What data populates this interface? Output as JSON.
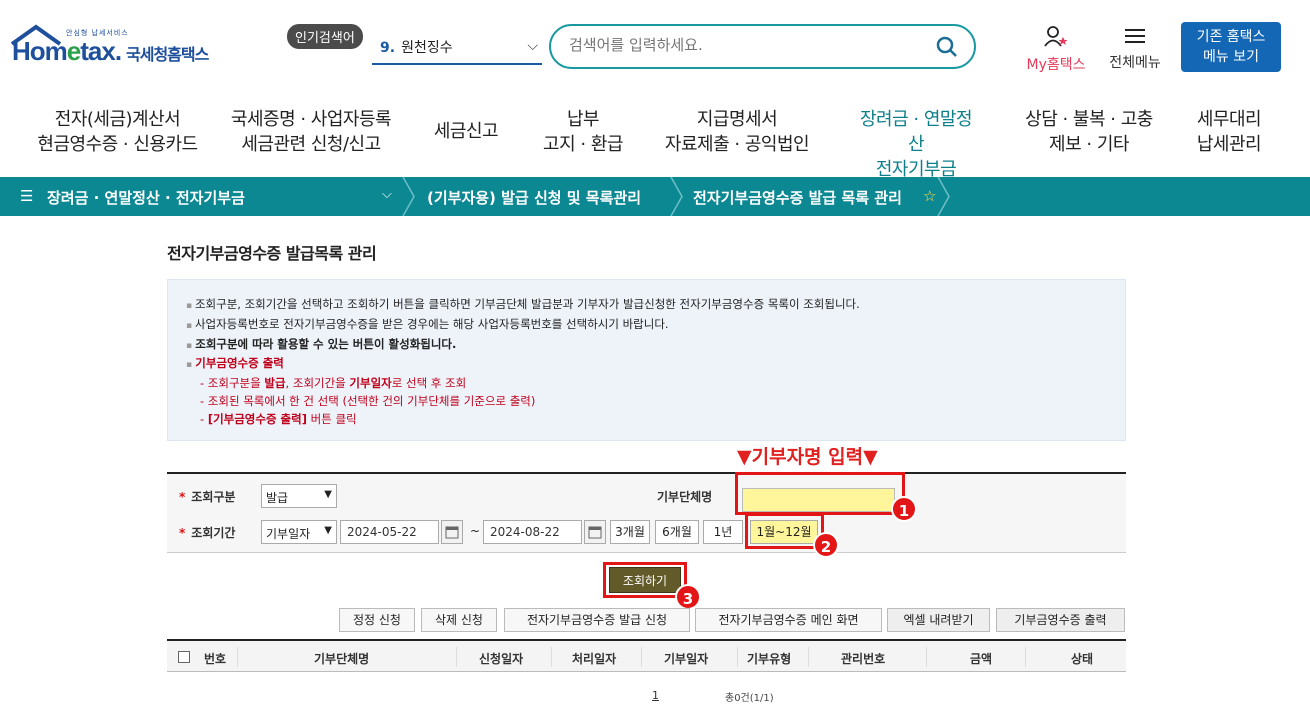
{
  "header": {
    "logo_small": "안심형 납세서비스",
    "logo_brand_a": "Hom",
    "logo_brand_e": "e",
    "logo_brand_b": "tax.",
    "logo_kr": "국세청홈택스",
    "popular_label": "인기검색어",
    "popular_num": "9.",
    "popular_text": "원천징수",
    "search_placeholder": "검색어를 입력하세요.",
    "my_hometax": "My홈택스",
    "all_menu": "전체메뉴",
    "old_menu_line1": "기존 홈택스",
    "old_menu_line2": "메뉴 보기"
  },
  "gnb": [
    {
      "l1": "전자(세금)계산서",
      "l2": "현금영수증 · 신용카드"
    },
    {
      "l1": "국세증명 · 사업자등록",
      "l2": "세금관련 신청/신고"
    },
    {
      "l1": "세금신고",
      "l2": ""
    },
    {
      "l1": "납부",
      "l2": "고지 · 환급"
    },
    {
      "l1": "지급명세서",
      "l2": "자료제출 · 공익법인"
    },
    {
      "l1": "장려금 · 연말정산",
      "l2": "전자기부금"
    },
    {
      "l1": "상담 · 불복 · 고충",
      "l2": "제보 · 기타"
    },
    {
      "l1": "세무대리",
      "l2": "납세관리"
    }
  ],
  "breadcrumb": {
    "b1": "장려금 · 연말정산 · 전자기부금",
    "b2": "(기부자용) 발급 신청 및 목록관리",
    "b3": "전자기부금영수증 발급 목록 관리"
  },
  "main": {
    "title": "전자기부금영수증 발급목록 관리",
    "info": [
      "조회구분, 조회기간을 선택하고 조회하기 버튼을 클릭하면 기부금단체 발급분과 기부자가 발급신청한 전자기부금영수증 목록이 조회됩니다.",
      "사업자등록번호로 전자기부금영수증을 받은 경우에는 해당 사업자등록번호를 선택하시기 바랍니다.",
      "조회구분에 따라 활용할 수 있는 버튼이 활성화됩니다.",
      "기부금영수증 출력"
    ],
    "info_sub1_a": "- 조회구분을 ",
    "info_sub1_b": "발급",
    "info_sub1_c": ", 조회기간을 ",
    "info_sub1_d": "기부일자",
    "info_sub1_e": "로 선택 후 조회",
    "info_sub2": "- 조회된 목록에서 한 건 선택 (선택한 건의 기부단체를 기준으로 출력)",
    "info_sub3_a": "- ",
    "info_sub3_b": "[기부금영수증 출력]",
    "info_sub3_c": " 버튼 클릭",
    "hint": "▼기부자명 입력▼"
  },
  "form": {
    "type_label": "조회구분",
    "type_value": "발급",
    "donor_label": "기부단체명",
    "period_label": "조회기간",
    "period_type": "기부일자",
    "date_from": "2024-05-22",
    "tilde": "~",
    "date_to": "2024-08-22",
    "p3m": "3개월",
    "p6m": "6개월",
    "p1y": "1년",
    "pfull": "1월~12월",
    "search_btn": "조회하기",
    "badge1": "1",
    "badge2": "2",
    "badge3": "3"
  },
  "actions": [
    "정정 신청",
    "삭제 신청",
    "전자기부금영수증 발급 신청",
    "전자기부금영수증 메인 화면",
    "엑셀 내려받기",
    "기부금영수증 출력"
  ],
  "table": {
    "headers": [
      "번호",
      "기부단체명",
      "신청일자",
      "처리일자",
      "기부일자",
      "기부유형",
      "관리번호",
      "금액",
      "상태"
    ],
    "page": "1",
    "total": "총0건(1/1)"
  },
  "colors": {
    "accent": "#0c8893",
    "brand": "#1d4f9c",
    "highlight": "#e21616"
  }
}
